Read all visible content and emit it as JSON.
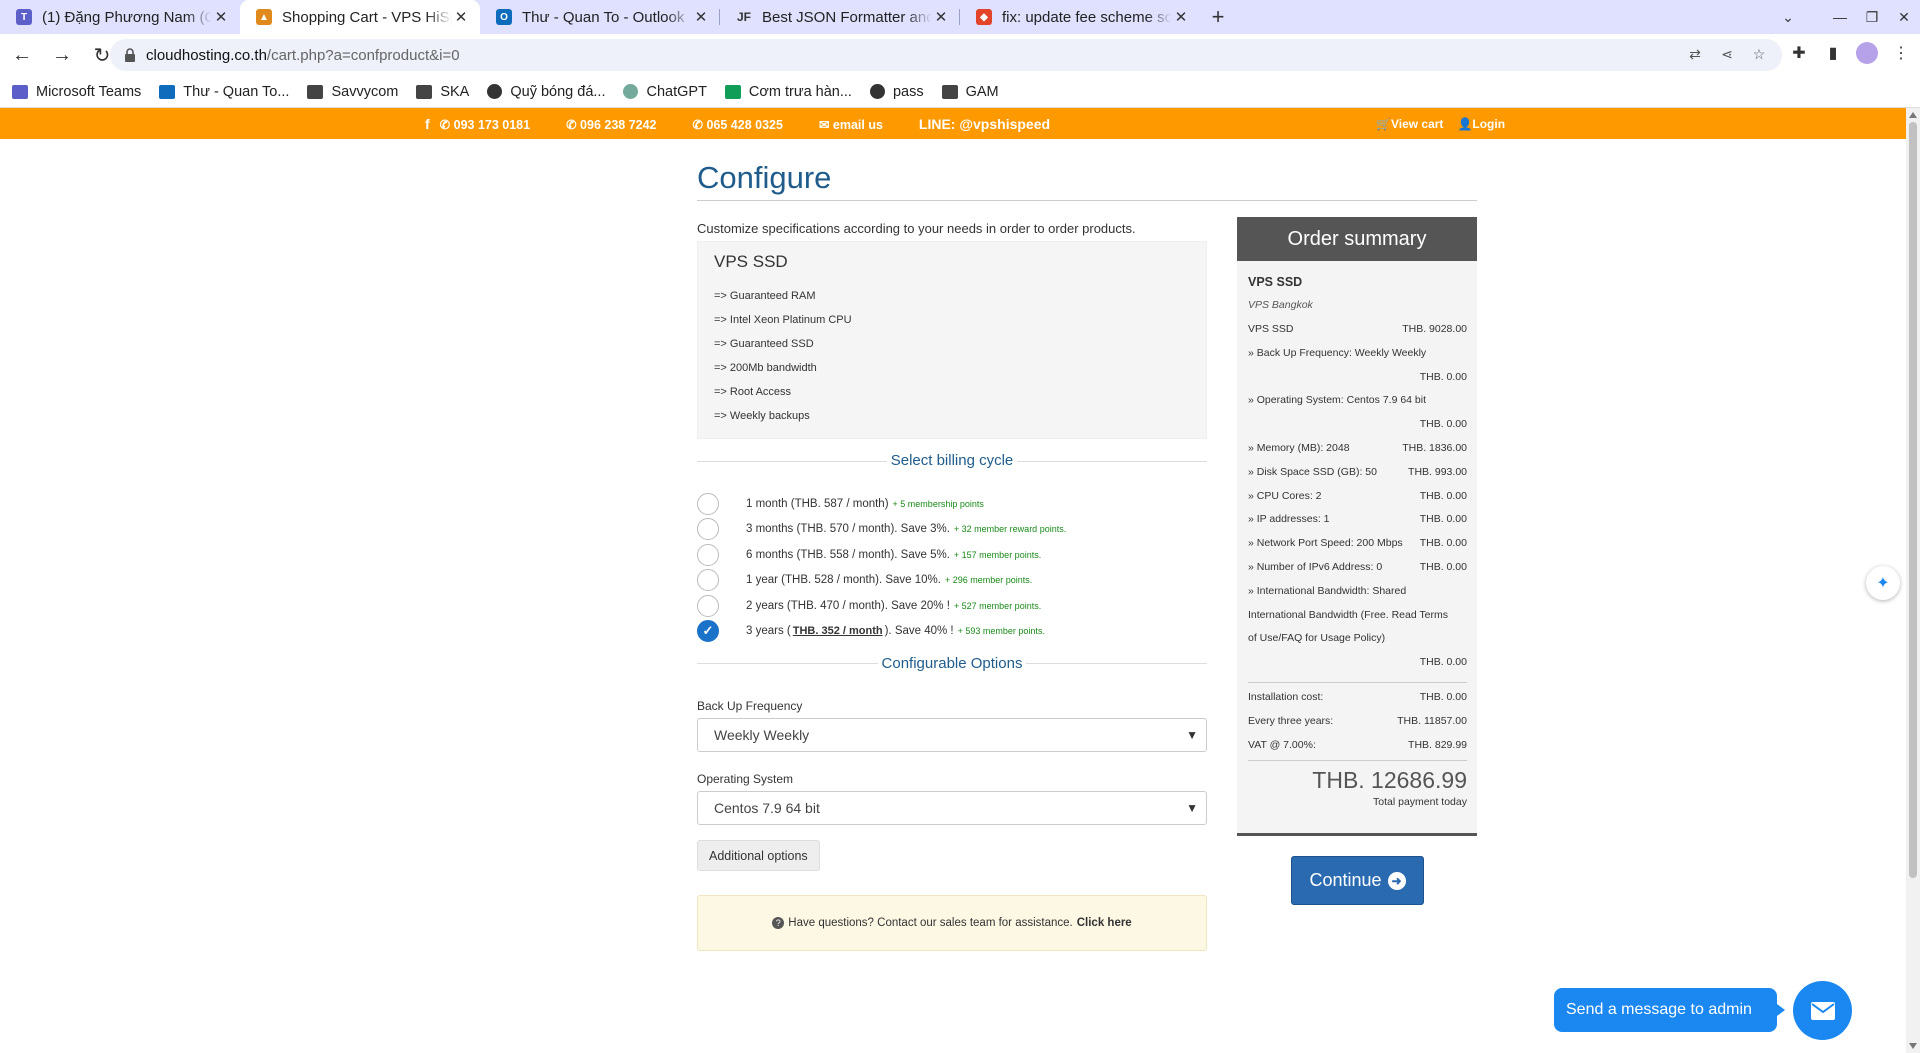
{
  "browser": {
    "tabs": [
      {
        "title": "(1) Đặng Phương Nam (C",
        "icon": "teams-icon",
        "color": "#5b5fc7"
      },
      {
        "title": "Shopping Cart - VPS HiSp",
        "icon": "tiger-icon",
        "color": "#e08a1e"
      },
      {
        "title": "Thư - Quan To - Outlook",
        "icon": "outlook-icon",
        "color": "#0f6cbd"
      },
      {
        "title": "Best JSON Formatter and",
        "icon": "jf-icon",
        "color": "#333333"
      },
      {
        "title": "fix: update fee scheme sc",
        "icon": "gitlab-icon",
        "color": "#e24329"
      }
    ],
    "url_host": "cloudhosting.co.th",
    "url_path": "/cart.php?a=confproduct&i=0",
    "bookmarks": [
      {
        "label": "Microsoft Teams",
        "icon": "teams-icon"
      },
      {
        "label": "Thư - Quan To...",
        "icon": "outlook-icon"
      },
      {
        "label": "Savvycom",
        "icon": "folder-icon"
      },
      {
        "label": "SKA",
        "icon": "folder-icon"
      },
      {
        "label": "Quỹ bóng đá...",
        "icon": "globe-icon"
      },
      {
        "label": "ChatGPT",
        "icon": "chatgpt-icon"
      },
      {
        "label": "Cơm trưa hàn...",
        "icon": "sheets-icon"
      },
      {
        "label": "pass",
        "icon": "globe-icon"
      },
      {
        "label": "GAM",
        "icon": "folder-icon"
      }
    ]
  },
  "topbar": {
    "facebook": "f",
    "phone1": "093 173 0181",
    "phone2": "096 238 7242",
    "phone3": "065 428 0325",
    "email": "email us",
    "line": "LINE: @vpshispeed",
    "view_cart": "View cart",
    "login": "Login",
    "bg_color": "#ff9900"
  },
  "page": {
    "title": "Configure",
    "intro": "Customize specifications according to your needs in order to order products."
  },
  "product": {
    "name": "VPS SSD",
    "features": [
      "=> Guaranteed RAM",
      "=> Intel Xeon Platinum CPU",
      "=> Guaranteed SSD",
      "=> 200Mb bandwidth",
      "=> Root Access",
      "=> Weekly backups"
    ]
  },
  "billing": {
    "title": "Select billing cycle",
    "cycles": [
      {
        "pre": "1 month (THB. 587 / month)",
        "price": "",
        "post": "",
        "points": "+ 5 membership points",
        "checked": false
      },
      {
        "pre": "3 months (THB. 570 / month). Save 3%.",
        "price": "",
        "post": "",
        "points": "+ 32 member reward points.",
        "checked": false
      },
      {
        "pre": "6 months (THB. 558 / month). Save 5%.",
        "price": "",
        "post": "",
        "points": "+ 157 member points.",
        "checked": false
      },
      {
        "pre": "1 year (THB. 528 / month). Save 10%.",
        "price": "",
        "post": "",
        "points": "+ 296 member points.",
        "checked": false
      },
      {
        "pre": "2 years (THB. 470 / month). Save 20% !",
        "price": "",
        "post": "",
        "points": "+ 527 member points.",
        "checked": false
      },
      {
        "pre": "3 years (",
        "price": "THB. 352 / month",
        "post": "). Save 40% !",
        "points": "+ 593 member points.",
        "checked": true
      }
    ]
  },
  "options": {
    "title": "Configurable Options",
    "backup_label": "Back Up Frequency",
    "backup_value": "Weekly Weekly",
    "os_label": "Operating System",
    "os_value": "Centos 7.9 64 bit",
    "additional": "Additional options"
  },
  "help": {
    "text": "Have questions? Contact our sales team for assistance.",
    "link": "Click here"
  },
  "summary": {
    "title": "Order summary",
    "product": "VPS SSD",
    "group": "VPS Bangkok",
    "lines": [
      {
        "label": "VPS SSD",
        "value": "THB. 9028.00"
      },
      {
        "label": "» Back Up Frequency: Weekly Weekly",
        "value": ""
      },
      {
        "label": "",
        "value": "THB. 0.00"
      },
      {
        "label": "» Operating System: Centos 7.9 64 bit",
        "value": ""
      },
      {
        "label": "",
        "value": "THB. 0.00"
      },
      {
        "label": "» Memory (MB): 2048",
        "value": "THB. 1836.00"
      },
      {
        "label": "» Disk Space SSD (GB): 50",
        "value": "THB. 993.00"
      },
      {
        "label": "» CPU Cores: 2",
        "value": "THB. 0.00"
      },
      {
        "label": "» IP addresses: 1",
        "value": "THB. 0.00"
      },
      {
        "label": "» Network Port Speed: 200 Mbps",
        "value": "THB. 0.00"
      },
      {
        "label": "» Number of IPv6 Address: 0",
        "value": "THB. 0.00"
      },
      {
        "label": "» International Bandwidth: Shared",
        "value": ""
      },
      {
        "label": "International Bandwidth (Free. Read Terms",
        "value": ""
      },
      {
        "label": "of Use/FAQ for Usage Policy)",
        "value": ""
      },
      {
        "label": "",
        "value": "THB. 0.00"
      }
    ],
    "costs": [
      {
        "label": "Installation cost:",
        "value": "THB. 0.00"
      },
      {
        "label": "Every three years:",
        "value": "THB. 11857.00"
      },
      {
        "label": "VAT @ 7.00%:",
        "value": "THB. 829.99"
      }
    ],
    "total": "THB. 12686.99",
    "total_label": "Total payment today"
  },
  "continue_label": "Continue",
  "chat": {
    "label": "Send a message to admin",
    "color": "#1a88f0"
  }
}
